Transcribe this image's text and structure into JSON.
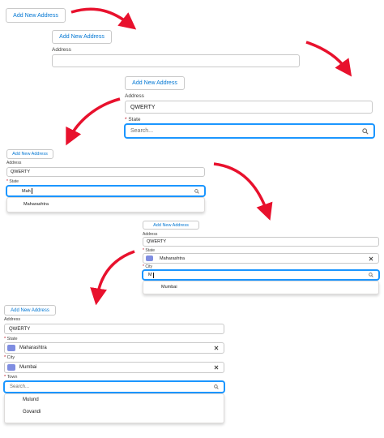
{
  "button_label": "Add New Address",
  "address_label": "Address",
  "address_value": "QWERTY",
  "state_label": "State",
  "city_label": "City",
  "town_label": "Town",
  "required_marker": "*",
  "search_placeholder": "Search...",
  "typed_state": "Mah",
  "typed_city": "M",
  "selected_state": "Maharashtra",
  "selected_city": "Mumbai",
  "state_option": "Maharashtra",
  "city_option": "Mumbai",
  "town_options": [
    "Mulund",
    "Govandi"
  ],
  "colors": {
    "arrow": "#e8112d",
    "brand": "#0176d3",
    "focus": "#1b96ff",
    "lookup_icon": "#7f8de1"
  },
  "icons": [
    "search-icon",
    "clear-icon",
    "lookup-record-icon",
    "arrow-annotation"
  ]
}
